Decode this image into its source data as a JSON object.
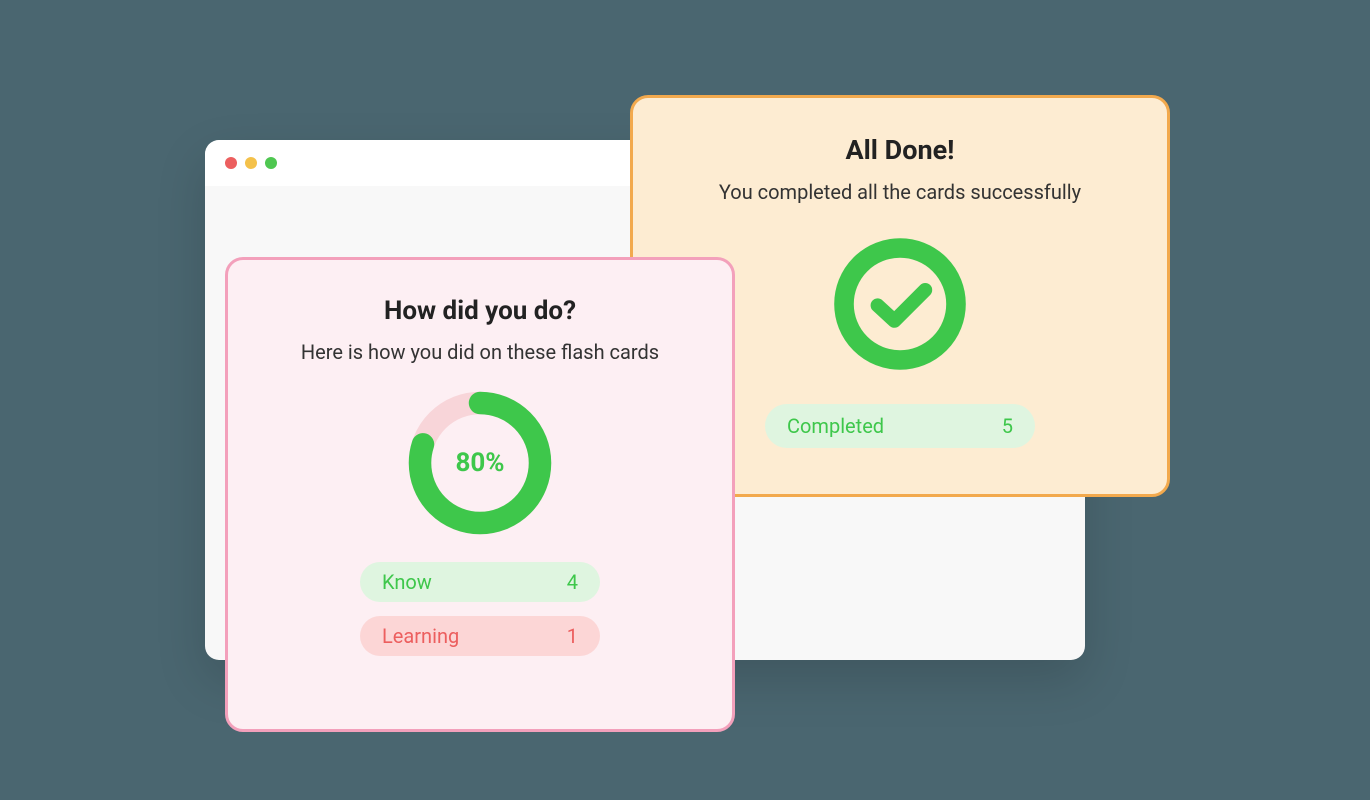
{
  "traffic_lights": [
    "red",
    "yellow",
    "green"
  ],
  "pink_card": {
    "title": "How did you do?",
    "subtitle": "Here is how you did on these flash cards",
    "progress_percent": 80,
    "progress_label": "80%",
    "stats": {
      "know": {
        "label": "Know",
        "value": "4"
      },
      "learning": {
        "label": "Learning",
        "value": "1"
      }
    }
  },
  "orange_card": {
    "title": "All Done!",
    "subtitle": "You completed all the cards successfully",
    "stats": {
      "completed": {
        "label": "Completed",
        "value": "5"
      }
    }
  },
  "colors": {
    "green": "#3ec74b",
    "green_light": "#dff5e0",
    "red": "#ec5f5f",
    "red_light": "#fcd6d6",
    "pink_border": "#f3a0bb",
    "pink_bg": "#fdeff3",
    "orange_border": "#f2a94d",
    "orange_bg": "#fdecd2",
    "donut_track": "#f8d5d9"
  }
}
